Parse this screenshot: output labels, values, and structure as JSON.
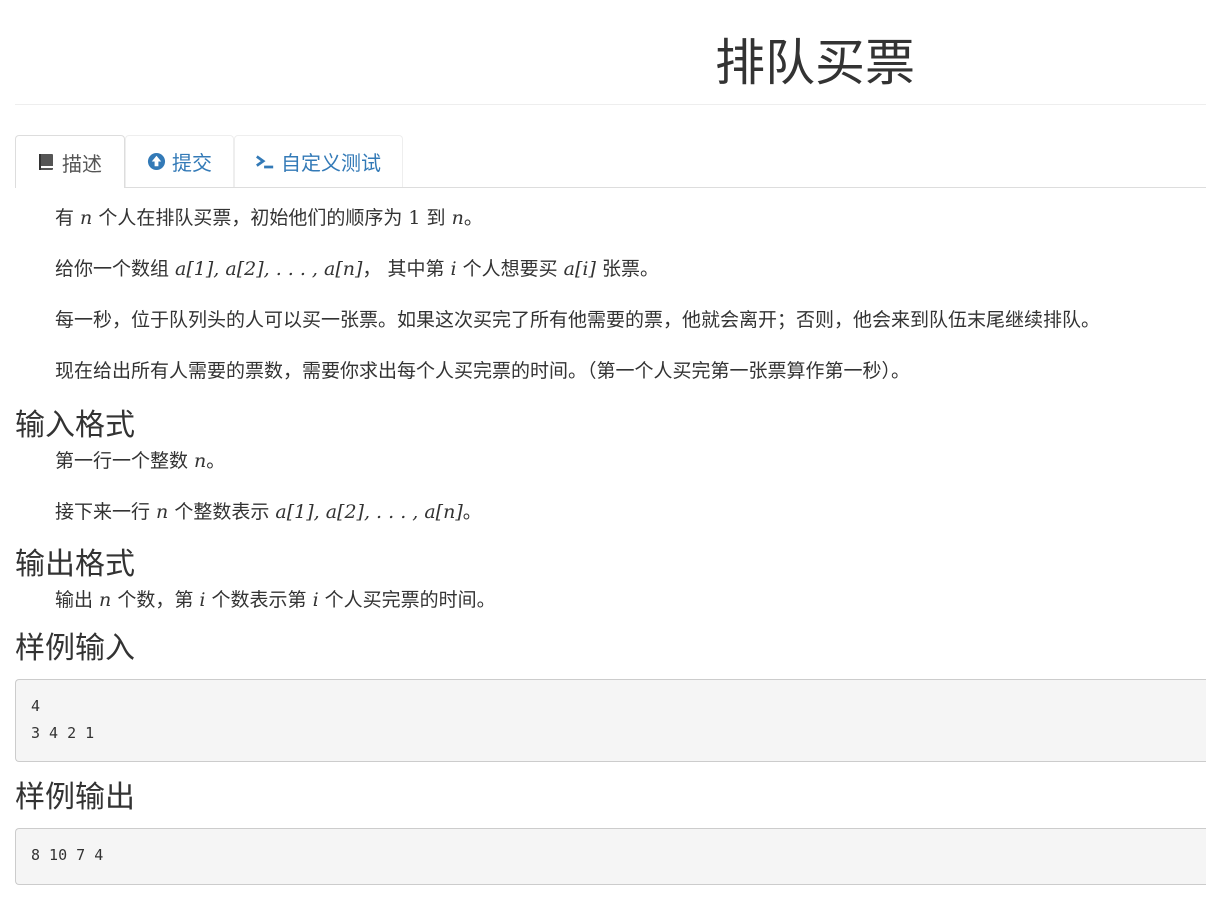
{
  "page": {
    "title": "排队买票"
  },
  "tabs": [
    {
      "label": "描述",
      "icon": "book-icon",
      "active": true
    },
    {
      "label": "提交",
      "icon": "upload-circle-icon",
      "active": false
    },
    {
      "label": "自定义测试",
      "icon": "terminal-icon",
      "active": false
    }
  ],
  "description": {
    "p1": {
      "a": "有 ",
      "n": "n",
      "b": " 个人在排队买票，初始他们的顺序为 ",
      "one": "1",
      "c": " 到 ",
      "n2": "n",
      "d": "。"
    },
    "p2": {
      "a": "给你一个数组 ",
      "arr": "a[1], a[2], . . . , a[n]",
      "b": "， 其中第 ",
      "i": "i",
      "c": " 个人想要买 ",
      "ai": "a[i]",
      "d": " 张票。"
    },
    "p3": "每一秒，位于队列头的人可以买一张票。如果这次买完了所有他需要的票，他就会离开；否则，他会来到队伍末尾继续排队。",
    "p4": "现在给出所有人需要的票数，需要你求出每个人买完票的时间。（第一个人买完第一张票算作第一秒）。"
  },
  "input_format": {
    "heading": "输入格式",
    "p1": {
      "a": "第一行一个整数 ",
      "n": "n",
      "b": "。"
    },
    "p2": {
      "a": "接下来一行 ",
      "n": "n",
      "b": " 个整数表示 ",
      "arr": "a[1], a[2], . . . , a[n]",
      "c": "。"
    }
  },
  "output_format": {
    "heading": "输出格式",
    "p1": {
      "a": "输出 ",
      "n": "n",
      "b": " 个数，第 ",
      "i": "i",
      "c": " 个数表示第 ",
      "i2": "i",
      "d": " 个人买完票的时间。"
    }
  },
  "sample_input": {
    "heading": "样例输入",
    "lines": [
      "4",
      "3 4 2 1"
    ]
  },
  "sample_output": {
    "heading": "样例输出",
    "lines": [
      "8 10 7 4"
    ]
  },
  "colors": {
    "link": "#337ab7",
    "text": "#333333",
    "code_bg": "#f5f5f5"
  }
}
